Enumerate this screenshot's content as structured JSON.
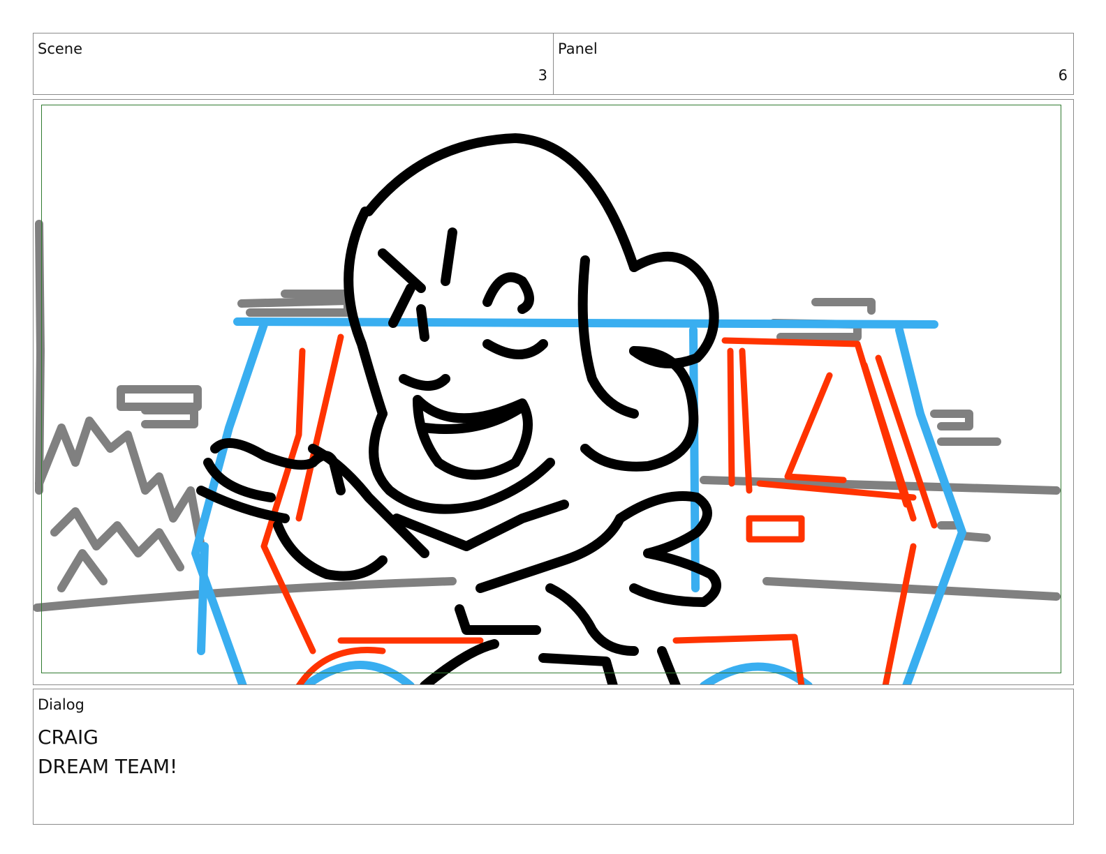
{
  "scene": {
    "label": "Scene",
    "value": "3"
  },
  "panel": {
    "label": "Panel",
    "value": "6"
  },
  "dialog": {
    "label": "Dialog",
    "lines": [
      "CRAIG",
      "DREAM TEAM!"
    ]
  },
  "colors": {
    "frame_border": "#8a8a8a",
    "safe_frame": "#2f7a2f",
    "sketch_black": "#000000",
    "sketch_blue": "#39aef0",
    "sketch_red": "#ff3300",
    "sketch_gray": "#808080"
  }
}
